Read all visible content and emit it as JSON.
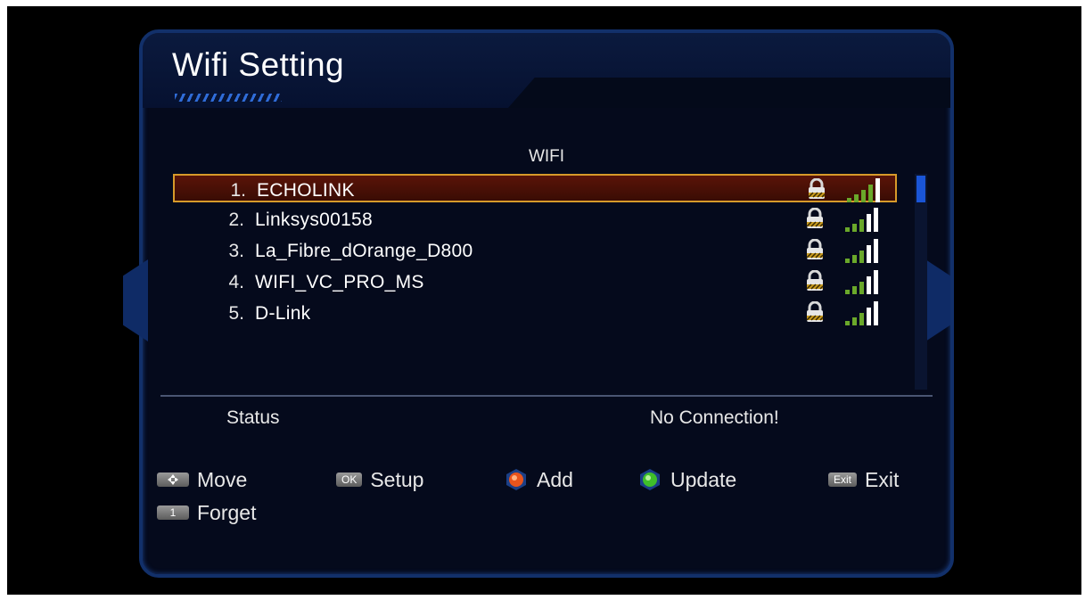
{
  "title": "Wifi Setting",
  "section_label": "WIFI",
  "networks": [
    {
      "num": "1.",
      "name": "ECHOLINK",
      "locked": true,
      "signal": 4
    },
    {
      "num": "2.",
      "name": "Linksys00158",
      "locked": true,
      "signal": 3
    },
    {
      "num": "3.",
      "name": "La_Fibre_dOrange_D800",
      "locked": true,
      "signal": 3
    },
    {
      "num": "4.",
      "name": "WIFI_VC_PRO_MS",
      "locked": true,
      "signal": 3
    },
    {
      "num": "5.",
      "name": "D-Link",
      "locked": true,
      "signal": 3
    }
  ],
  "selected_index": 0,
  "status": {
    "label": "Status",
    "value": "No Connection!"
  },
  "hints": {
    "move": {
      "key": "",
      "label": "Move",
      "icon": "arrows-icon"
    },
    "setup": {
      "key": "OK",
      "label": "Setup"
    },
    "add": {
      "label": "Add",
      "color": "#e8541c"
    },
    "update": {
      "label": "Update",
      "color": "#3fbf2a"
    },
    "exit": {
      "key": "Exit",
      "label": "Exit"
    },
    "forget": {
      "key": "1",
      "label": "Forget"
    }
  },
  "colors": {
    "selection_border": "#d79a2a",
    "selection_fill": "#5a1408",
    "frame_border": "#12306a",
    "signal_active": "#6aa82a",
    "signal_inactive": "#ffffff",
    "scroll_thumb": "#1a55d6"
  }
}
